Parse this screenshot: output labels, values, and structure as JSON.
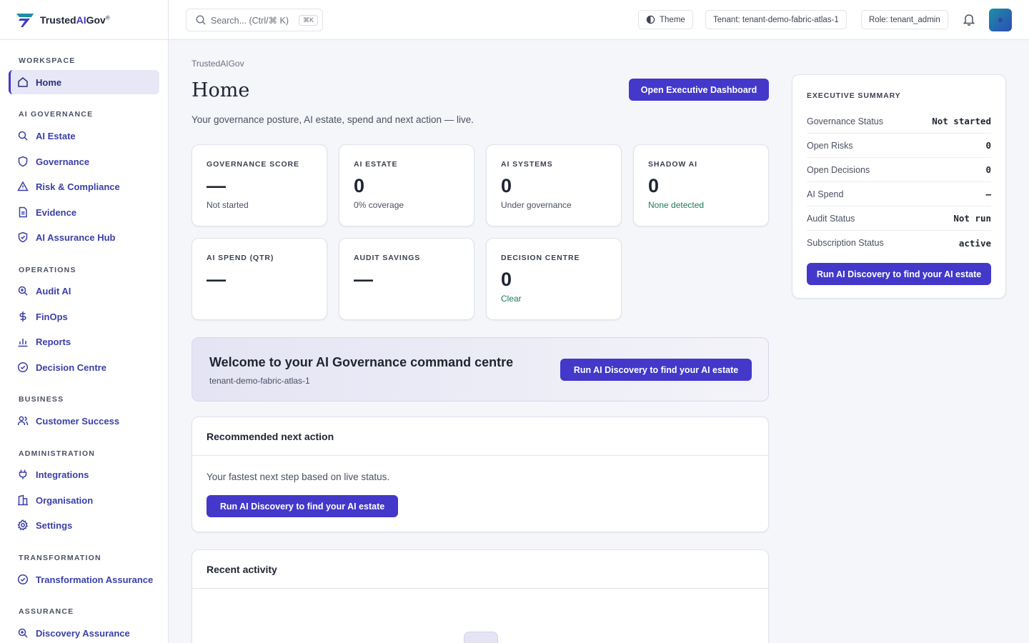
{
  "brand": {
    "name_prefix": "Trusted",
    "name_ai": "AI",
    "name_suffix": "Gov",
    "mark": "®"
  },
  "topbar": {
    "search_placeholder": "Search... (Ctrl/⌘ K)",
    "search_kbd": "⌘K",
    "theme_label": "Theme",
    "tenant_label": "Tenant: tenant-demo-fabric-atlas-1",
    "role_label": "Role: tenant_admin"
  },
  "sidebar": {
    "sections": [
      {
        "title": "Workspace",
        "items": [
          {
            "label": "Home",
            "icon": "home-icon",
            "active": true
          }
        ]
      },
      {
        "title": "AI Governance",
        "items": [
          {
            "label": "AI Estate",
            "icon": "search-icon"
          },
          {
            "label": "Governance",
            "icon": "shield-icon"
          },
          {
            "label": "Risk & Compliance",
            "icon": "warning-triangle-icon"
          },
          {
            "label": "Evidence",
            "icon": "document-icon"
          },
          {
            "label": "AI Assurance Hub",
            "icon": "shield-check-icon"
          }
        ]
      },
      {
        "title": "Operations",
        "items": [
          {
            "label": "Audit AI",
            "icon": "zoom-icon"
          },
          {
            "label": "FinOps",
            "icon": "dollar-icon"
          },
          {
            "label": "Reports",
            "icon": "bar-chart-icon"
          },
          {
            "label": "Decision Centre",
            "icon": "check-circle-icon"
          }
        ]
      },
      {
        "title": "Business",
        "items": [
          {
            "label": "Customer Success",
            "icon": "users-icon"
          }
        ]
      },
      {
        "title": "Administration",
        "items": [
          {
            "label": "Integrations",
            "icon": "plug-icon"
          },
          {
            "label": "Organisation",
            "icon": "building-icon"
          },
          {
            "label": "Settings",
            "icon": "gear-icon"
          }
        ]
      },
      {
        "title": "Transformation",
        "items": [
          {
            "label": "Transformation Assurance",
            "icon": "check-circle-icon"
          }
        ]
      },
      {
        "title": "Assurance",
        "items": [
          {
            "label": "Discovery Assurance",
            "icon": "zoom-icon"
          }
        ]
      }
    ]
  },
  "main": {
    "breadcrumb": "TrustedAIGov",
    "title": "Home",
    "subtitle": "Your governance posture, AI estate, spend and next action — live.",
    "exec_button": "Open Executive Dashboard",
    "kpis": [
      {
        "label": "Governance Score",
        "value": "—",
        "sub": "Not started",
        "sub_color": "default"
      },
      {
        "label": "AI Estate",
        "value": "0",
        "sub": "0% coverage",
        "sub_color": "default"
      },
      {
        "label": "AI Systems",
        "value": "0",
        "sub": "Under governance",
        "sub_color": "default"
      },
      {
        "label": "Shadow AI",
        "value": "0",
        "sub": "None detected",
        "sub_color": "green"
      },
      {
        "label": "AI Spend (QTR)",
        "value": "—",
        "sub": "",
        "sub_color": "default"
      },
      {
        "label": "Audit Savings",
        "value": "—",
        "sub": "",
        "sub_color": "default"
      },
      {
        "label": "Decision Centre",
        "value": "0",
        "sub": "Clear",
        "sub_color": "green"
      }
    ],
    "welcome": {
      "title": "Welcome to your AI Governance command centre",
      "tenant": "tenant-demo-fabric-atlas-1",
      "button": "Run AI Discovery to find your AI estate"
    },
    "next_action": {
      "title": "Recommended next action",
      "text": "Your fastest next step based on live status.",
      "button": "Run AI Discovery to find your AI estate"
    },
    "recent_activity": {
      "title": "Recent activity"
    }
  },
  "summary": {
    "title": "Executive Summary",
    "rows": [
      {
        "label": "Governance Status",
        "value": "Not started"
      },
      {
        "label": "Open Risks",
        "value": "0"
      },
      {
        "label": "Open Decisions",
        "value": "0"
      },
      {
        "label": "AI Spend",
        "value": "—"
      },
      {
        "label": "Audit Status",
        "value": "Not run"
      },
      {
        "label": "Subscription Status",
        "value": "active"
      }
    ],
    "button": "Run AI Discovery to find your AI estate"
  },
  "colors": {
    "accent": "#4338ca",
    "success": "#1e7a5a",
    "background": "#f5f6fa"
  }
}
